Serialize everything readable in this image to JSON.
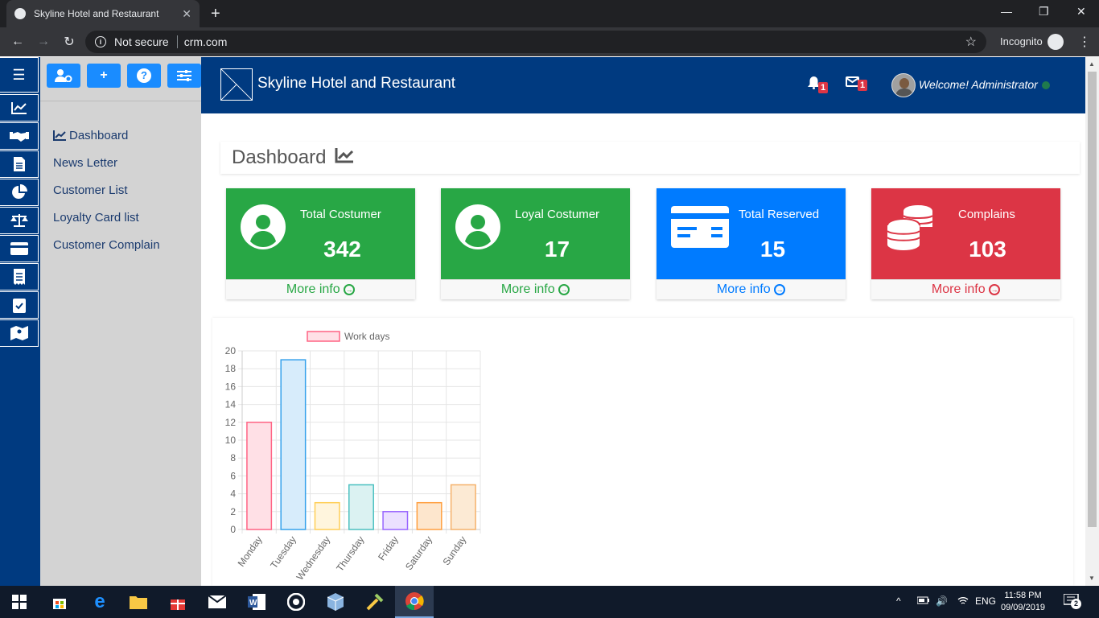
{
  "browser": {
    "tab_title": "Skyline Hotel and Restaurant",
    "tab_close": "✕",
    "new_tab": "+",
    "security_label": "Not secure",
    "url": "crm.com",
    "incognito_label": "Incognito"
  },
  "app": {
    "brand_name": "Skyline Hotel and Restaurant",
    "notifications_count": "1",
    "messages_count": "1",
    "welcome_text": "Welcome! Administrator"
  },
  "sidebar": {
    "menu": [
      {
        "label": "Dashboard",
        "icon": "chart-line-icon"
      },
      {
        "label": "News Letter"
      },
      {
        "label": "Customer List"
      },
      {
        "label": "Loyalty Card list"
      },
      {
        "label": "Customer Complain"
      }
    ],
    "rail_icons": [
      "hamburger-icon",
      "chart-line-icon",
      "handshake-icon",
      "document-icon",
      "pie-chart-icon",
      "balance-scale-icon",
      "credit-card-icon",
      "receipt-icon",
      "clipboard-check-icon",
      "map-icon"
    ],
    "toolbar_icons": [
      "user-settings-icon",
      "plus-icon",
      "help-icon",
      "sliders-icon"
    ]
  },
  "dashboard": {
    "title": "Dashboard",
    "cards": [
      {
        "label": "Total Costumer",
        "value": "342",
        "more": "More info",
        "color": "#28a745",
        "foot_color": "#28a745",
        "icon": "user-circle-icon"
      },
      {
        "label": "Loyal Costumer",
        "value": "17",
        "more": "More info",
        "color": "#28a745",
        "foot_color": "#28a745",
        "icon": "user-circle-icon"
      },
      {
        "label": "Total Reserved",
        "value": "15",
        "more": "More info",
        "color": "#007bff",
        "foot_color": "#007bff",
        "icon": "credit-card-icon"
      },
      {
        "label": "Complains",
        "value": "103",
        "more": "More info",
        "color": "#dc3545",
        "foot_color": "#dc3545",
        "icon": "coins-icon"
      }
    ]
  },
  "chart_data": {
    "type": "bar",
    "categories": [
      "Monday",
      "Tuesday",
      "Wednesday",
      "Thursday",
      "Friday",
      "Saturday",
      "Sunday"
    ],
    "series": [
      {
        "name": "Work days",
        "values": [
          12,
          19,
          3,
          5,
          2,
          3,
          5
        ]
      }
    ],
    "ylim": [
      0,
      20
    ],
    "yticks": [
      "0",
      "2",
      "4",
      "6",
      "8",
      "10",
      "12",
      "14",
      "16",
      "18",
      "20"
    ],
    "grid": true,
    "legend": "top",
    "bar_fills": [
      "#ffe0e6",
      "#d7ecfb",
      "#fff5dd",
      "#dbf2f2",
      "#ebe0ff",
      "#fde6cd",
      "#fcead4"
    ],
    "bar_strokes": [
      "#ff6384",
      "#36a2eb",
      "#ffce56",
      "#4bc0c0",
      "#9966ff",
      "#ff9f40",
      "#f5b26b"
    ]
  },
  "taskbar": {
    "language": "ENG",
    "time": "11:58 PM",
    "date": "09/09/2019",
    "notification_count": "2"
  }
}
